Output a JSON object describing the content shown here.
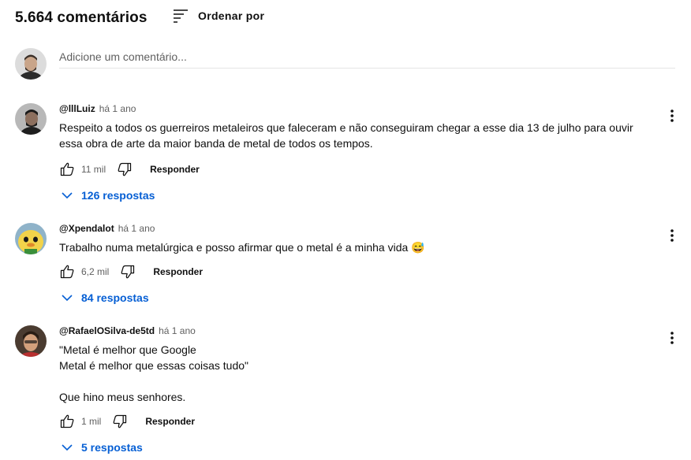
{
  "header": {
    "count_label": "5.664 comentários",
    "sort_label": "Ordenar por"
  },
  "add_comment": {
    "placeholder": "Adicione um comentário..."
  },
  "comments": [
    {
      "handle": "@lllLuiz",
      "time": "há 1 ano",
      "text": "Respeito a todos os guerreiros metaleiros que faleceram e não conseguiram chegar a esse dia 13 de julho para ouvir essa obra de arte da maior banda de metal de todos os tempos.",
      "likes": "11 mil",
      "reply_label": "Responder",
      "replies_label": "126 respostas"
    },
    {
      "handle": "@Xpendalot",
      "time": "há 1 ano",
      "text": "Trabalho numa metalúrgica e posso afirmar que o metal é a minha vida 😅",
      "likes": "6,2 mil",
      "reply_label": "Responder",
      "replies_label": "84 respostas"
    },
    {
      "handle": "@RafaelOSilva-de5td",
      "time": "há 1 ano",
      "text": "\"Metal é melhor que Google\n Metal é melhor que essas coisas tudo\"\n\nQue hino meus senhores.",
      "likes": "1 mil",
      "reply_label": "Responder",
      "replies_label": "5 respostas"
    }
  ]
}
